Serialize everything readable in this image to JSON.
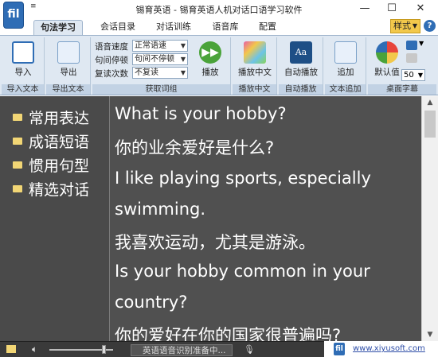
{
  "window": {
    "title": "锡育英语 - 锡育英语人机对话口语学习软件",
    "menu_arrow": "≡",
    "min": "—",
    "max": "☐",
    "close": "✕",
    "app_icon_text": "fil"
  },
  "tabs": [
    {
      "label": "句法学习",
      "active": true
    },
    {
      "label": "会话目录",
      "active": false
    },
    {
      "label": "对话训练",
      "active": false
    },
    {
      "label": "语音库",
      "active": false
    },
    {
      "label": "配置",
      "active": false
    }
  ],
  "style_menu": "样式",
  "help": "?",
  "ribbon": {
    "import_text": {
      "button": "导入",
      "group": "导入文本"
    },
    "export_text": {
      "button": "导出",
      "group": "导出文本"
    },
    "get_words": {
      "group": "获取词组",
      "rows": [
        {
          "label": "语音速度",
          "value": "正常语速"
        },
        {
          "label": "句间停顿",
          "value": "句间不停顿"
        },
        {
          "label": "复读次数",
          "value": "不复读"
        }
      ],
      "play": "播放"
    },
    "play_chinese": {
      "button": "播放中文",
      "group": "播放中文"
    },
    "auto_play": {
      "button": "自动播放",
      "group": "自动播放"
    },
    "text_append": {
      "button": "追加",
      "group": "文本追加"
    },
    "desktop_subtitle": {
      "button": "默认值",
      "group": "桌面字幕",
      "number": "50"
    },
    "colors": {
      "blue": "#2f6db5",
      "green": "#4aa33a",
      "gold": "#f2c84b"
    }
  },
  "nav": {
    "items": [
      "常用表达",
      "成语短语",
      "惯用句型",
      "精选对话"
    ]
  },
  "content": {
    "lines": [
      "What is your hobby?",
      "你的业余爱好是什么?",
      "I like playing sports, especially",
      "swimming.",
      "我喜欢运动，尤其是游泳。",
      "Is your hobby common in your",
      "country?",
      "你的爱好在你的国家很普遍吗?"
    ]
  },
  "statusbar": {
    "status_text": "英语语音识别准备中...",
    "site_url": "www.xiyusoft.com"
  }
}
